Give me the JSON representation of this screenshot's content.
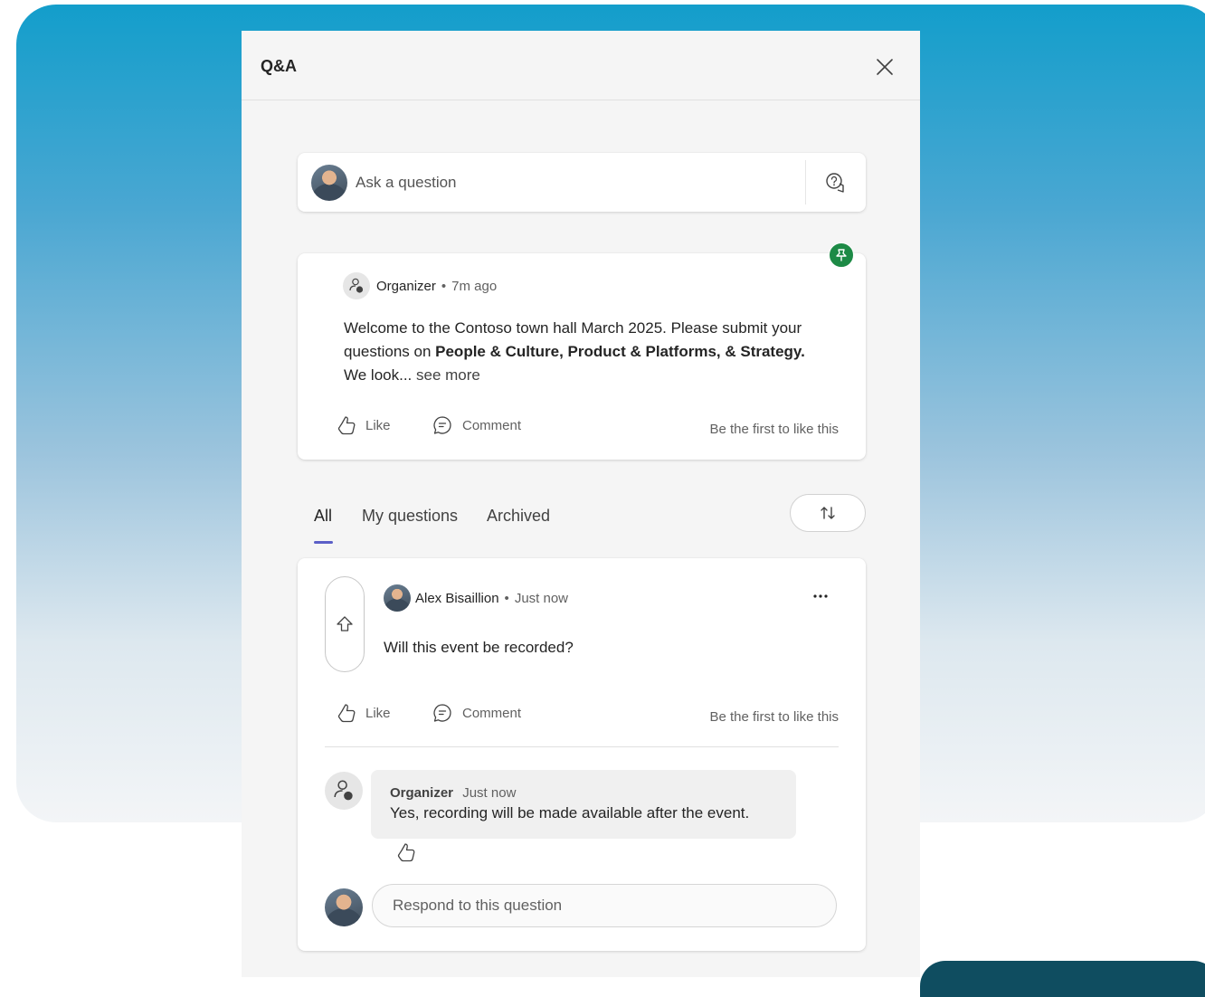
{
  "panel": {
    "title": "Q&A"
  },
  "ask": {
    "placeholder": "Ask a question"
  },
  "pinned": {
    "author": "Organizer",
    "time": "7m ago",
    "text_1": "Welcome to the Contoso town hall March 2025. Please submit your questions on ",
    "text_bold": "People & Culture, Product & Platforms, & Strategy.",
    "text_2": " We look...",
    "see_more": "see more",
    "like_label": "Like",
    "comment_label": "Comment",
    "like_note": "Be the first to like this"
  },
  "tabs": [
    {
      "label": "All"
    },
    {
      "label": "My questions"
    },
    {
      "label": "Archived"
    }
  ],
  "question": {
    "author": "Alex Bisaillion",
    "time": "Just now",
    "text": "Will this event be recorded?",
    "like_label": "Like",
    "comment_label": "Comment",
    "like_note": "Be the first to like this",
    "reply": {
      "author": "Organizer",
      "time": "Just now",
      "text": "Yes, recording will be made available after the event."
    },
    "respond_placeholder": "Respond to this question"
  },
  "colors": {
    "accent": "#5b5fc7",
    "pin_badge": "#1d8a46",
    "panel_bg": "#f5f5f5"
  },
  "icons": {
    "close": "close-icon",
    "ask": "ask-question-icon",
    "pin": "pin-icon",
    "like": "thumbs-up-icon",
    "comment": "comment-icon",
    "sort": "sort-icon",
    "upvote": "upvote-arrow-icon",
    "more": "more-options-icon"
  }
}
